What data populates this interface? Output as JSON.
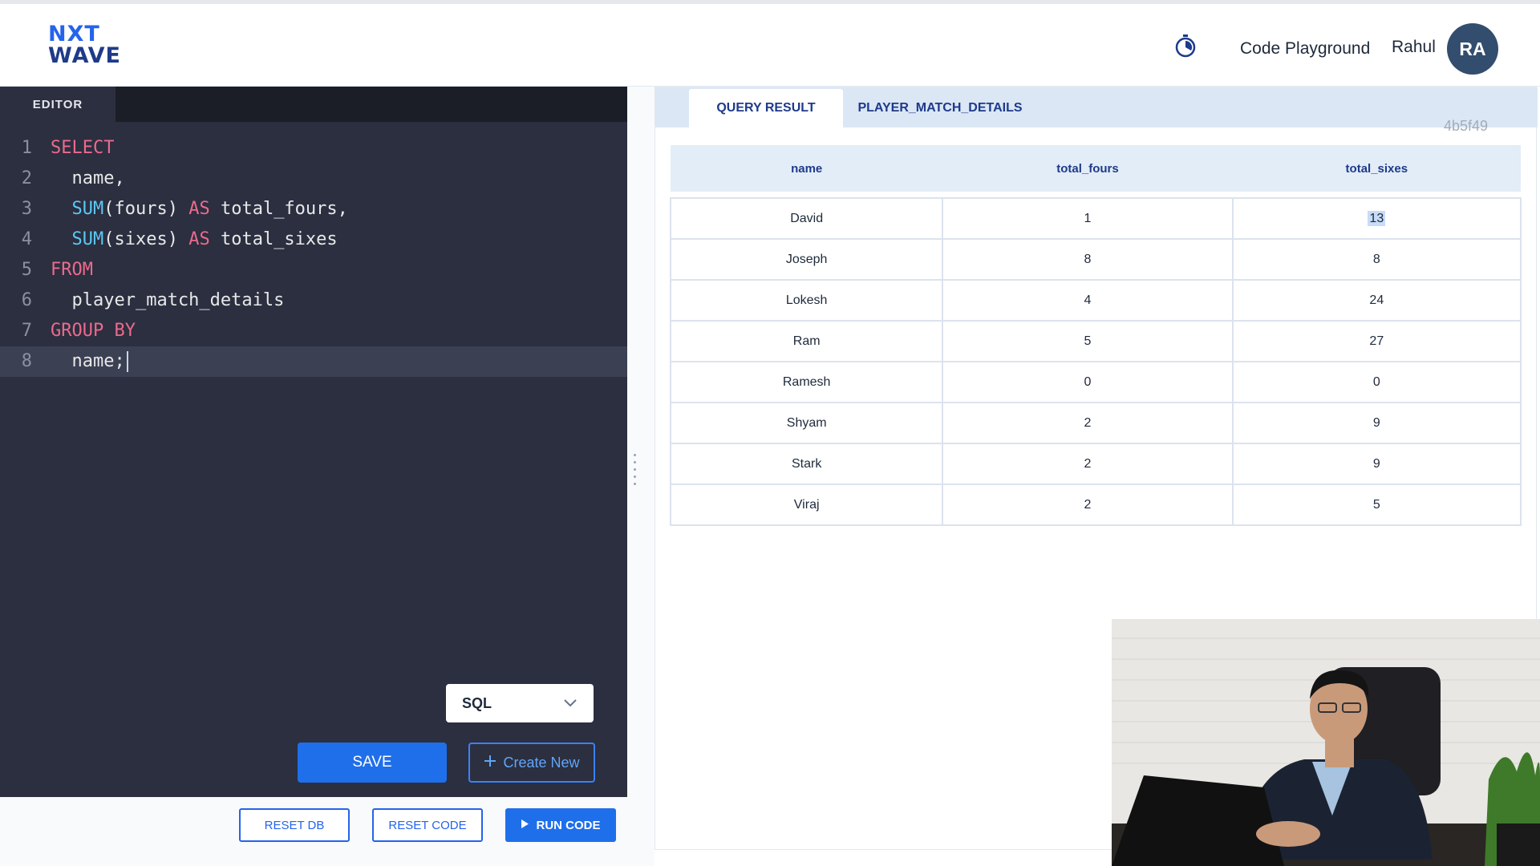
{
  "header": {
    "logo": {
      "line1": "NXT",
      "line2": "WAVE"
    },
    "nav_label": "Code Playground",
    "user_name": "Rahul",
    "avatar_initials": "RA",
    "icons": {
      "timer": "stopwatch-icon"
    }
  },
  "editor": {
    "tab_label": "EDITOR",
    "lines": [
      {
        "n": "1",
        "tokens": [
          {
            "t": "SELECT",
            "c": "kw"
          }
        ]
      },
      {
        "n": "2",
        "tokens": [
          {
            "t": "  name,",
            "c": ""
          }
        ]
      },
      {
        "n": "3",
        "tokens": [
          {
            "t": "  ",
            "c": ""
          },
          {
            "t": "SUM",
            "c": "fn"
          },
          {
            "t": "(fours) ",
            "c": ""
          },
          {
            "t": "AS",
            "c": "kw"
          },
          {
            "t": " total_fours,",
            "c": ""
          }
        ]
      },
      {
        "n": "4",
        "tokens": [
          {
            "t": "  ",
            "c": ""
          },
          {
            "t": "SUM",
            "c": "fn"
          },
          {
            "t": "(sixes) ",
            "c": ""
          },
          {
            "t": "AS",
            "c": "kw"
          },
          {
            "t": " total_sixes",
            "c": ""
          }
        ]
      },
      {
        "n": "5",
        "tokens": [
          {
            "t": "FROM",
            "c": "kw"
          }
        ]
      },
      {
        "n": "6",
        "tokens": [
          {
            "t": "  player_match_details",
            "c": ""
          }
        ]
      },
      {
        "n": "7",
        "tokens": [
          {
            "t": "GROUP BY",
            "c": "kw"
          }
        ]
      },
      {
        "n": "8",
        "tokens": [
          {
            "t": "  name;",
            "c": ""
          }
        ],
        "active": true
      }
    ],
    "language": "SQL",
    "save_label": "SAVE",
    "create_label": "Create New"
  },
  "actions": {
    "reset_db": "RESET DB",
    "reset_code": "RESET CODE",
    "run_code": "RUN CODE"
  },
  "results": {
    "tabs": [
      "QUERY RESULT",
      "PLAYER_MATCH_DETAILS"
    ],
    "active_tab": 0,
    "hash": "4b5f49",
    "columns": [
      "name",
      "total_fours",
      "total_sixes"
    ],
    "rows": [
      [
        "David",
        "1",
        "13"
      ],
      [
        "Joseph",
        "8",
        "8"
      ],
      [
        "Lokesh",
        "4",
        "24"
      ],
      [
        "Ram",
        "5",
        "27"
      ],
      [
        "Ramesh",
        "0",
        "0"
      ],
      [
        "Shyam",
        "2",
        "9"
      ],
      [
        "Stark",
        "2",
        "9"
      ],
      [
        "Viraj",
        "2",
        "5"
      ]
    ]
  },
  "colors": {
    "editor_bg": "#2b2f40",
    "keyword": "#ec6a8c",
    "function": "#5cc8f2",
    "primary": "#1f6feb",
    "header_text": "#1e3a8a"
  }
}
